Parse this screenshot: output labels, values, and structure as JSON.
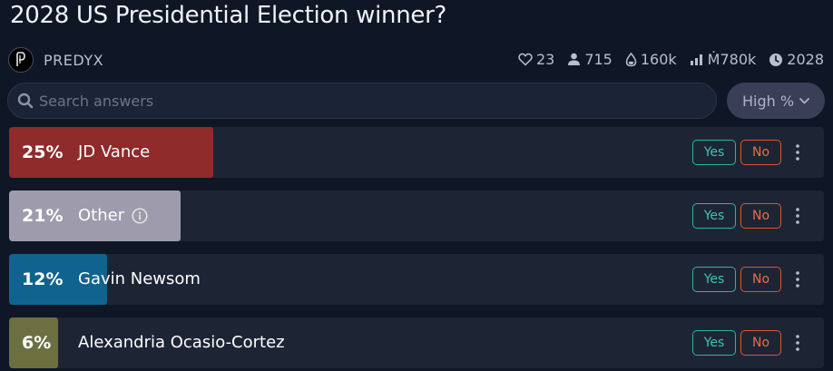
{
  "title": "2028 US Presidential Election winner?",
  "creator": {
    "name": "PREDYX"
  },
  "stats": {
    "likes": "23",
    "traders": "715",
    "liquidity": "160k",
    "volume": "Ṁ780k",
    "close_year": "2028"
  },
  "search": {
    "placeholder": "Search answers",
    "value": ""
  },
  "sort": {
    "label": "High %"
  },
  "colors": {
    "yes": "#2bb59b",
    "no": "#e0532f",
    "row_bg": "#1d2535"
  },
  "answers": [
    {
      "pct_label": "25%",
      "probability": 0.25,
      "label": "JD Vance",
      "bar_color": "#8f2b2b",
      "yes_label": "Yes",
      "no_label": "No",
      "has_info": false
    },
    {
      "pct_label": "21%",
      "probability": 0.21,
      "label": "Other",
      "bar_color": "#9e9cac",
      "yes_label": "Yes",
      "no_label": "No",
      "has_info": true
    },
    {
      "pct_label": "12%",
      "probability": 0.12,
      "label": "Gavin Newsom",
      "bar_color": "#11638f",
      "yes_label": "Yes",
      "no_label": "No",
      "has_info": false
    },
    {
      "pct_label": "6%",
      "probability": 0.06,
      "label": "Alexandria Ocasio-Cortez",
      "bar_color": "#6c7041",
      "yes_label": "Yes",
      "no_label": "No",
      "has_info": false
    }
  ]
}
